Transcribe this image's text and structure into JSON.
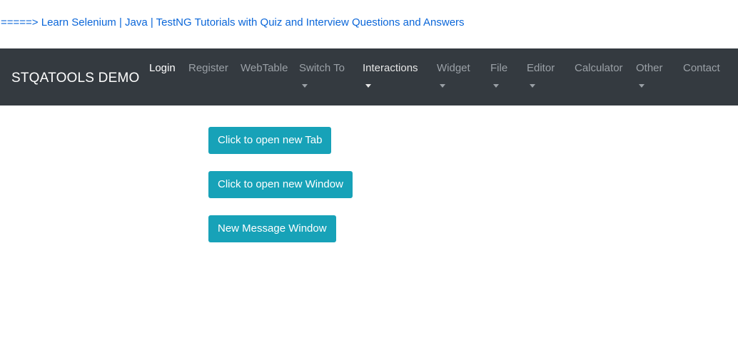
{
  "banner": {
    "link_text": "=====> Learn Selenium | Java | TestNG Tutorials with Quiz and Interview Questions and Answers"
  },
  "navbar": {
    "brand": "STQATOOLS DEMO",
    "items": [
      {
        "label": "Login",
        "dropdown": false
      },
      {
        "label": "Register",
        "dropdown": false
      },
      {
        "label": "WebTable",
        "dropdown": false
      },
      {
        "label": "Switch To",
        "dropdown": true
      },
      {
        "label": "Interactions",
        "dropdown": true
      },
      {
        "label": "Widget",
        "dropdown": true
      },
      {
        "label": "File",
        "dropdown": true
      },
      {
        "label": "Editor",
        "dropdown": true
      },
      {
        "label": "Calculator",
        "dropdown": false
      },
      {
        "label": "Other",
        "dropdown": true
      },
      {
        "label": "Contact",
        "dropdown": false
      }
    ]
  },
  "main": {
    "buttons": [
      {
        "label": "Click to open new Tab"
      },
      {
        "label": "Click to open new Window"
      },
      {
        "label": "New Message Window"
      }
    ]
  },
  "colors": {
    "navbar_bg": "#343a40",
    "button_bg": "#17a2b8",
    "link": "#0a66d9"
  }
}
